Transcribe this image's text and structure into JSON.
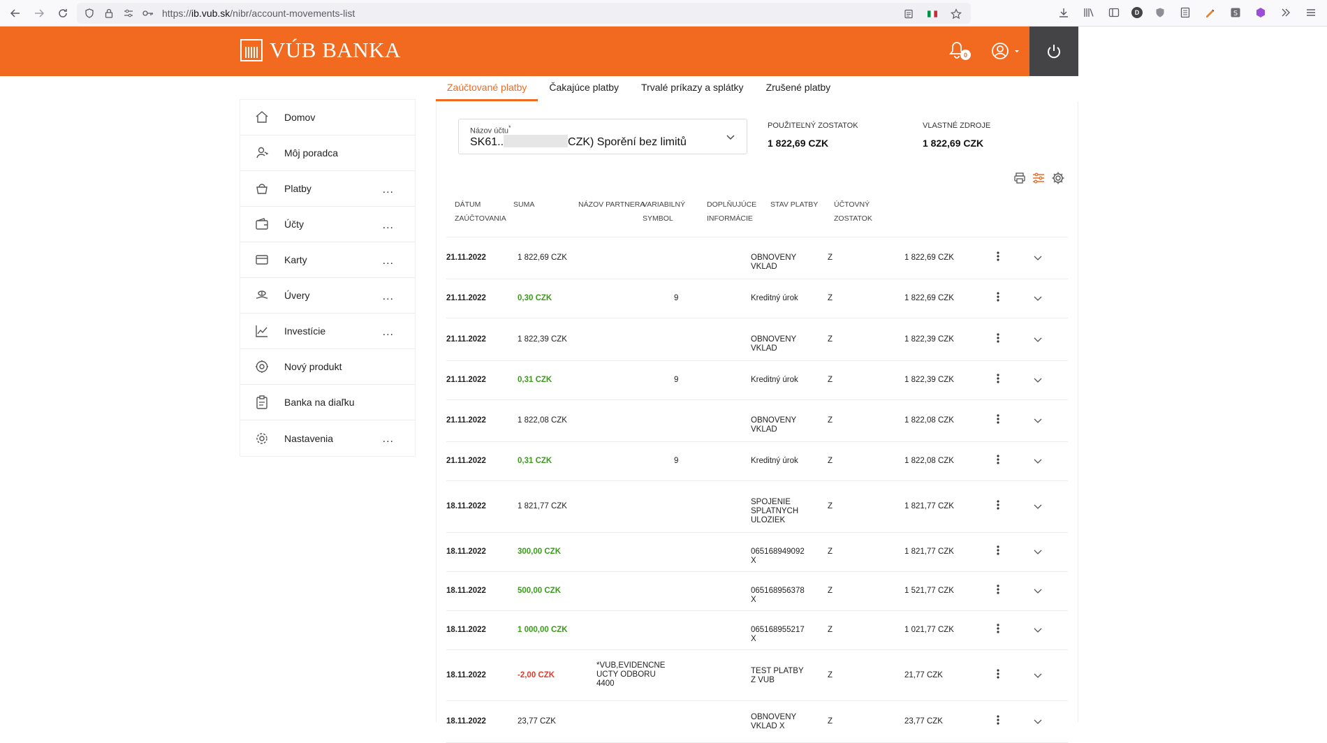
{
  "browser": {
    "url_prefix": "https://",
    "url_host": "ib.vub.sk",
    "url_path": "/nibr/account-movements-list",
    "ext_badge": "D"
  },
  "header": {
    "logo_text": "VÚB BANKA",
    "notification_count": "0",
    "accent": "#f26a1f"
  },
  "sidebar": {
    "items": [
      {
        "label": "Domov",
        "icon": "home-icon",
        "more": ""
      },
      {
        "label": "Môj poradca",
        "icon": "advisor-icon",
        "more": ""
      },
      {
        "label": "Platby",
        "icon": "payments-icon",
        "more": "..."
      },
      {
        "label": "Účty",
        "icon": "wallet-icon",
        "more": "..."
      },
      {
        "label": "Karty",
        "icon": "card-icon",
        "more": "..."
      },
      {
        "label": "Úvery",
        "icon": "loan-icon",
        "more": "..."
      },
      {
        "label": "Investície",
        "icon": "chart-icon",
        "more": "..."
      },
      {
        "label": "Nový produkt",
        "icon": "new-product-icon",
        "more": ""
      },
      {
        "label": "Banka na diaľku",
        "icon": "clipboard-icon",
        "more": ""
      },
      {
        "label": "Nastavenia",
        "icon": "gear-icon",
        "more": "..."
      }
    ]
  },
  "tabs": [
    {
      "label": "Zaúčtované platby",
      "active": true
    },
    {
      "label": "Čakajúce platby",
      "active": false
    },
    {
      "label": "Trvalé príkazy a splátky",
      "active": false
    },
    {
      "label": "Zrušené platby",
      "active": false
    }
  ],
  "account": {
    "label": "Názov účtu",
    "required_mark": "*",
    "value_start": "SK61..",
    "value_end": "CZK) Sporění bez limitů"
  },
  "balances": {
    "usable_title": "POUŽITEĽNÝ ZOSTATOK",
    "usable_value": "1 822,69 CZK",
    "own_title": "VLASTNÉ ZDROJE",
    "own_value": "1 822,69 CZK"
  },
  "table": {
    "headers": {
      "date": [
        "DÁTUM",
        "ZAÚČTOVANIA"
      ],
      "amount": [
        "SUMA"
      ],
      "partner": [
        "NÁZOV PARTNERA"
      ],
      "vs": [
        "VARIABILNÝ",
        "SYMBOL"
      ],
      "info": [
        "DOPLŇUJÚCE",
        "INFORMÁCIE"
      ],
      "status": [
        "STAV PLATBY"
      ],
      "balance": [
        "ÚČTOVNÝ",
        "ZOSTATOK"
      ]
    },
    "rows": [
      {
        "date": "21.11.2022",
        "amount": "1 822,69 CZK",
        "type": "",
        "partner": "",
        "vs": "",
        "info": "OBNOVENY VKLAD",
        "status": "Z",
        "balance": "1 822,69 CZK"
      },
      {
        "date": "21.11.2022",
        "amount": "0,30 CZK",
        "type": "pos",
        "partner": "",
        "vs": "9",
        "info": "Kreditný úrok",
        "status": "Z",
        "balance": "1 822,69 CZK"
      },
      {
        "date": "21.11.2022",
        "amount": "1 822,39 CZK",
        "type": "",
        "partner": "",
        "vs": "",
        "info": "OBNOVENY VKLAD",
        "status": "Z",
        "balance": "1 822,39 CZK"
      },
      {
        "date": "21.11.2022",
        "amount": "0,31 CZK",
        "type": "pos",
        "partner": "",
        "vs": "9",
        "info": "Kreditný úrok",
        "status": "Z",
        "balance": "1 822,39 CZK"
      },
      {
        "date": "21.11.2022",
        "amount": "1 822,08 CZK",
        "type": "",
        "partner": "",
        "vs": "",
        "info": "OBNOVENY VKLAD",
        "status": "Z",
        "balance": "1 822,08 CZK"
      },
      {
        "date": "21.11.2022",
        "amount": "0,31 CZK",
        "type": "pos",
        "partner": "",
        "vs": "9",
        "info": "Kreditný úrok",
        "status": "Z",
        "balance": "1 822,08 CZK"
      },
      {
        "date": "18.11.2022",
        "amount": "1 821,77 CZK",
        "type": "",
        "partner": "",
        "vs": "",
        "info": "SPOJENIE SPLATNYCH ULOZIEK",
        "status": "Z",
        "balance": "1 821,77 CZK"
      },
      {
        "date": "18.11.2022",
        "amount": "300,00 CZK",
        "type": "pos",
        "partner": "",
        "vs": "",
        "info": "065168949092 X",
        "status": "Z",
        "balance": "1 821,77 CZK"
      },
      {
        "date": "18.11.2022",
        "amount": "500,00 CZK",
        "type": "pos",
        "partner": "",
        "vs": "",
        "info": "065168956378 X",
        "status": "Z",
        "balance": "1 521,77 CZK"
      },
      {
        "date": "18.11.2022",
        "amount": "1 000,00 CZK",
        "type": "pos",
        "partner": "",
        "vs": "",
        "info": "065168955217 X",
        "status": "Z",
        "balance": "1 021,77 CZK"
      },
      {
        "date": "18.11.2022",
        "amount": "-2,00 CZK",
        "type": "neg",
        "partner": "*VUB,EVIDENCNE UCTY ODBORU 4400",
        "vs": "",
        "info": "TEST PLATBY Z VUB",
        "status": "Z",
        "balance": "21,77 CZK"
      },
      {
        "date": "18.11.2022",
        "amount": "23,77 CZK",
        "type": "",
        "partner": "",
        "vs": "",
        "info": "OBNOVENY VKLAD X",
        "status": "Z",
        "balance": "23,77 CZK"
      }
    ]
  }
}
